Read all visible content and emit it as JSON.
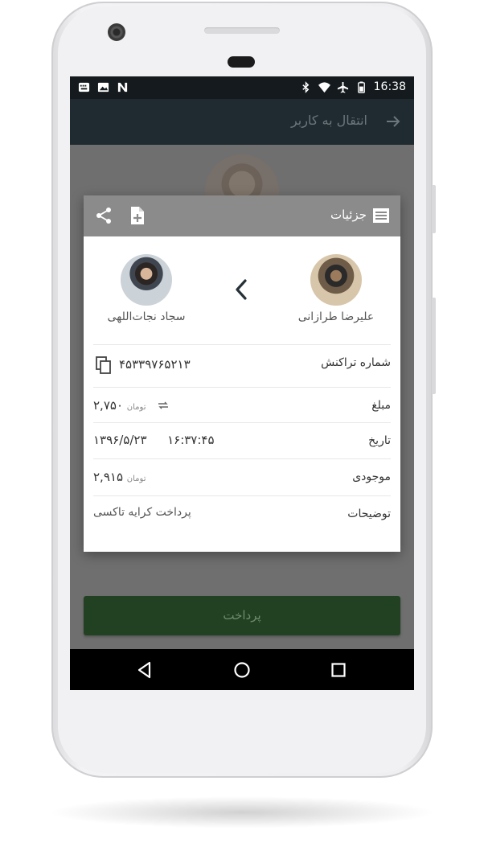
{
  "status": {
    "time": "16:38",
    "left_icons": [
      "keyboard-icon",
      "image-icon",
      "n-app-icon"
    ],
    "right_icons": [
      "bluetooth-icon",
      "wifi-icon",
      "airplane-icon",
      "battery-icon"
    ]
  },
  "appbar": {
    "title": "انتقال به کاربر",
    "back_icon": "arrow-right-icon"
  },
  "dialog": {
    "title": "جزئیات",
    "receiver_name": "سجاد نجات‌اللهی",
    "sender_name": "علیرضا طرازانی",
    "rows": {
      "transaction": {
        "label": "شماره تراکنش",
        "value": "۴۵۳۳۹۷۶۵۲۱۳"
      },
      "amount": {
        "label": "مبلغ",
        "value": "۲,۷۵۰",
        "unit": "تومان"
      },
      "date": {
        "label": "تاریخ",
        "date": "۱۳۹۶/۵/۲۳",
        "time": "۱۶:۳۷:۴۵"
      },
      "balance": {
        "label": "موجودی",
        "value": "۲,۹۱۵",
        "unit": "تومان"
      },
      "description": {
        "label": "توضیحات",
        "value": "پرداخت کرایه تاکسی"
      }
    }
  },
  "pay_button": {
    "label": "پرداخت"
  },
  "colors": {
    "appbar": "#1f2b30",
    "dialog_header": "#8b8b8b",
    "pay_button": "#224122",
    "overlay": "#6f6f6f"
  }
}
